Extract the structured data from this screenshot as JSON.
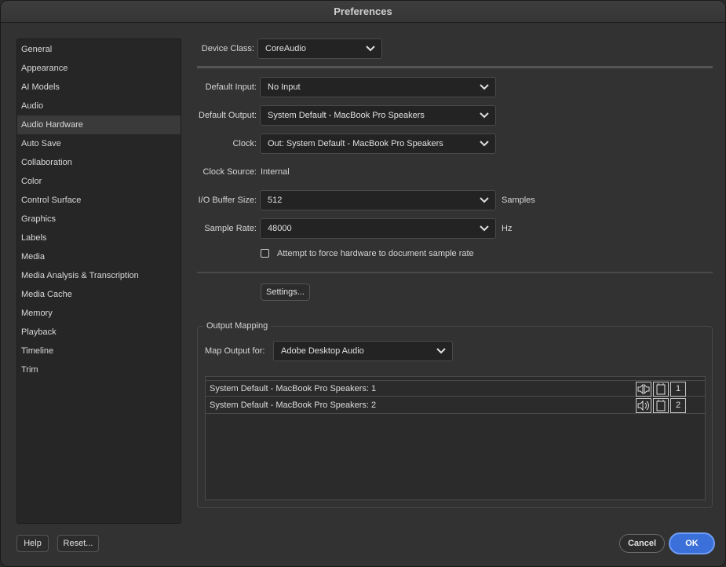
{
  "window": {
    "title": "Preferences"
  },
  "sidebar": {
    "items": [
      {
        "label": "General"
      },
      {
        "label": "Appearance"
      },
      {
        "label": "AI Models"
      },
      {
        "label": "Audio"
      },
      {
        "label": "Audio Hardware",
        "selected": true
      },
      {
        "label": "Auto Save"
      },
      {
        "label": "Collaboration"
      },
      {
        "label": "Color"
      },
      {
        "label": "Control Surface"
      },
      {
        "label": "Graphics"
      },
      {
        "label": "Labels"
      },
      {
        "label": "Media"
      },
      {
        "label": "Media Analysis & Transcription"
      },
      {
        "label": "Media Cache"
      },
      {
        "label": "Memory"
      },
      {
        "label": "Playback"
      },
      {
        "label": "Timeline"
      },
      {
        "label": "Trim"
      }
    ]
  },
  "device_class": {
    "label": "Device Class:",
    "value": "CoreAudio"
  },
  "default_input": {
    "label": "Default Input:",
    "value": "No Input"
  },
  "default_output": {
    "label": "Default Output:",
    "value": "System Default - MacBook Pro Speakers"
  },
  "clock": {
    "label": "Clock:",
    "value": "Out: System Default - MacBook Pro Speakers"
  },
  "clock_source": {
    "label": "Clock Source:",
    "value": "Internal"
  },
  "io_buffer": {
    "label": "I/O Buffer Size:",
    "value": "512",
    "unit": "Samples"
  },
  "sample_rate": {
    "label": "Sample Rate:",
    "value": "48000",
    "unit": "Hz"
  },
  "force_rate": {
    "label": "Attempt to force hardware to document sample rate",
    "checked": false
  },
  "settings_button": "Settings...",
  "output_mapping": {
    "title": "Output Mapping",
    "map_label": "Map Output for:",
    "map_value": "Adobe Desktop Audio",
    "rows": [
      {
        "name": "System Default - MacBook Pro Speakers: 1",
        "channel": "1"
      },
      {
        "name": "System Default - MacBook Pro Speakers: 2",
        "channel": "2"
      }
    ]
  },
  "footer": {
    "help": "Help",
    "reset": "Reset...",
    "cancel": "Cancel",
    "ok": "OK"
  },
  "colors": {
    "accent": "#3b6fd9",
    "background": "#323232",
    "selected_item": "#3a3a3a"
  }
}
